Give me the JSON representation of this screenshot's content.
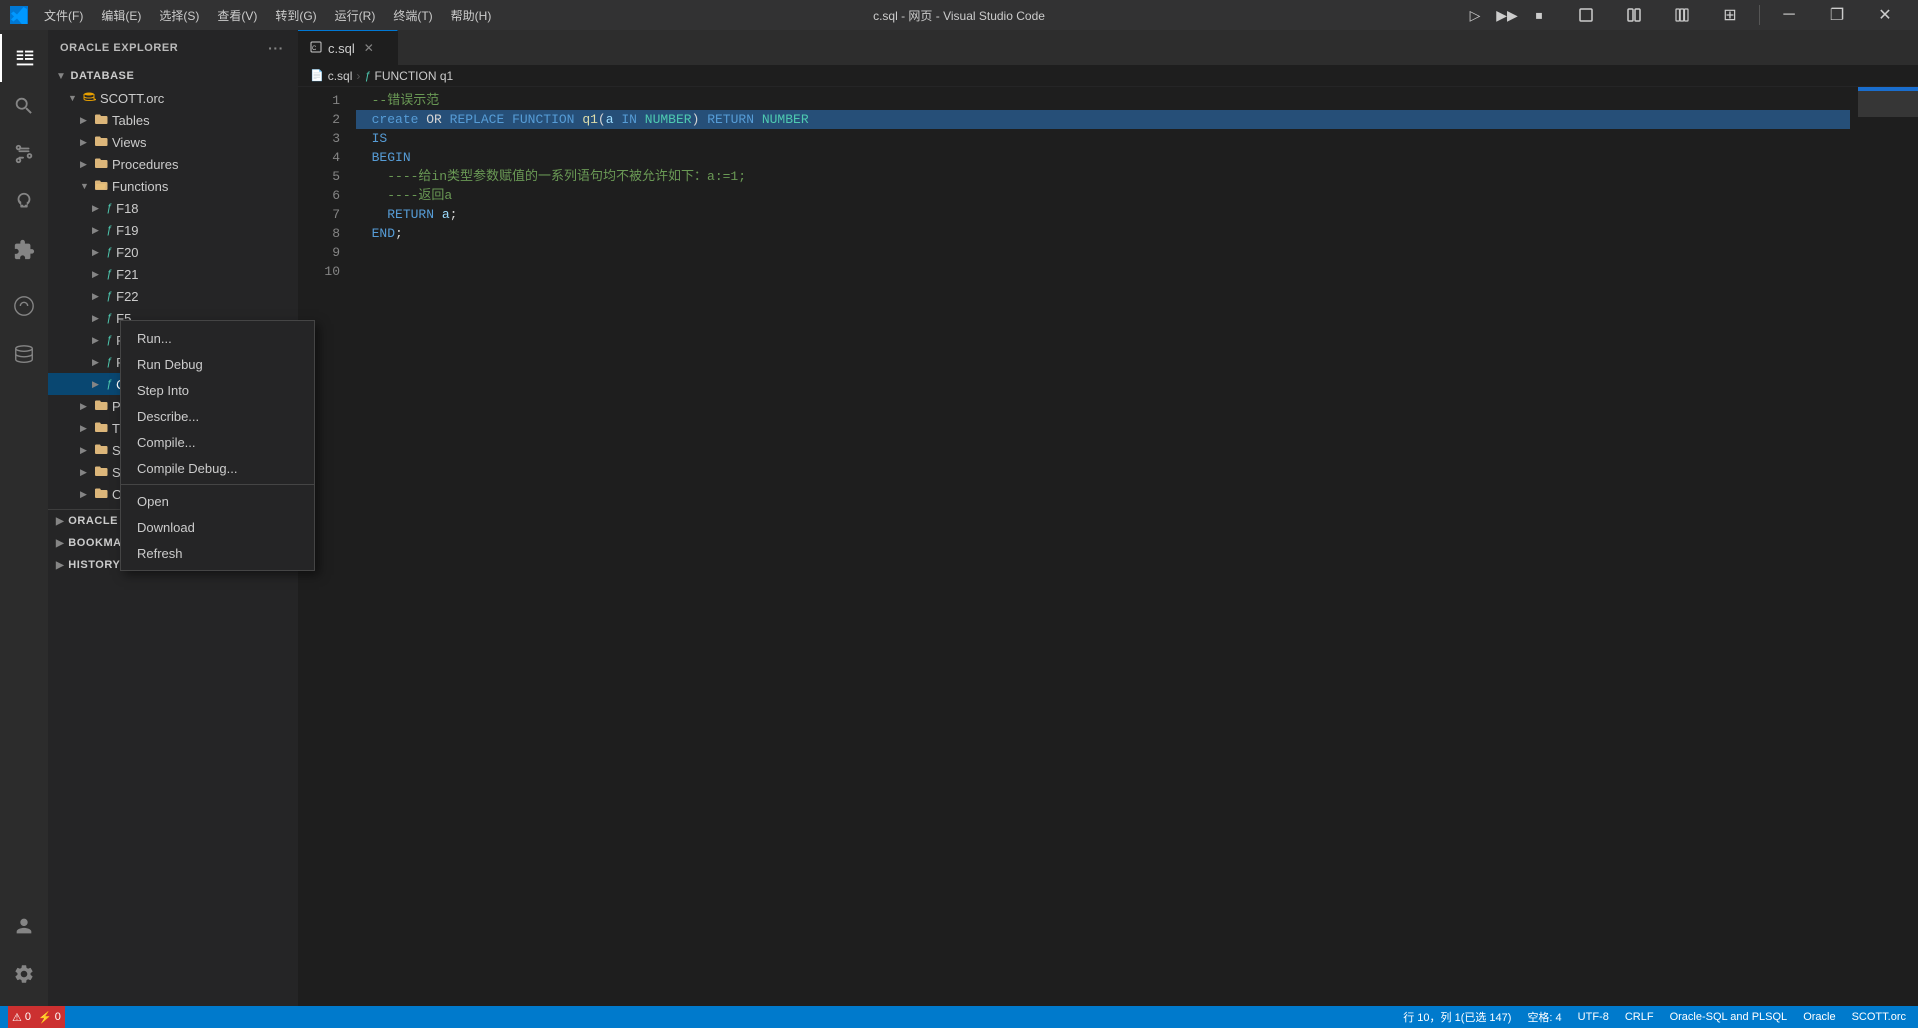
{
  "titlebar": {
    "logo": "◆",
    "menus": [
      "文件(F)",
      "编辑(E)",
      "选择(S)",
      "查看(V)",
      "转到(G)",
      "运行(R)",
      "终端(T)",
      "帮助(H)"
    ],
    "title": "c.sql - 网页 - Visual Studio Code",
    "btn_minimize": "─",
    "btn_restore": "⧠",
    "btn_maximize": "❐",
    "btn_layout": "⊞",
    "btn_close": "✕"
  },
  "activity_bar": {
    "icons": [
      {
        "name": "explorer-icon",
        "symbol": "⎘",
        "active": true
      },
      {
        "name": "search-icon",
        "symbol": "🔍",
        "active": false
      },
      {
        "name": "source-control-icon",
        "symbol": "⑂",
        "active": false
      },
      {
        "name": "run-debug-icon",
        "symbol": "▷",
        "active": false
      },
      {
        "name": "extensions-icon",
        "symbol": "⊞",
        "active": false
      },
      {
        "name": "oracle-icon",
        "symbol": "⬡",
        "active": false
      },
      {
        "name": "database-icon",
        "symbol": "🗄",
        "active": false
      }
    ],
    "bottom_icons": [
      {
        "name": "accounts-icon",
        "symbol": "◎"
      },
      {
        "name": "settings-icon",
        "symbol": "⚙"
      }
    ]
  },
  "sidebar": {
    "header": "ORACLE EXPLORER",
    "more_icon": "···",
    "sections": {
      "database": {
        "label": "DATABASE",
        "expanded": true,
        "items": [
          {
            "label": "SCOTT.orc",
            "level": 2,
            "expanded": true,
            "icon": "🗄",
            "children": [
              {
                "label": "Tables",
                "level": 3,
                "icon": "📁",
                "expanded": false
              },
              {
                "label": "Views",
                "level": 3,
                "icon": "📁",
                "expanded": false
              },
              {
                "label": "Procedures",
                "level": 3,
                "icon": "📁",
                "expanded": false
              },
              {
                "label": "Functions",
                "level": 3,
                "icon": "📁",
                "expanded": true,
                "children": [
                  {
                    "label": "F18",
                    "level": 4,
                    "icon": "ƒ",
                    "selected": false
                  },
                  {
                    "label": "F19",
                    "level": 4,
                    "icon": "ƒ",
                    "selected": false
                  },
                  {
                    "label": "F20",
                    "level": 4,
                    "icon": "ƒ",
                    "selected": false
                  },
                  {
                    "label": "F21",
                    "level": 4,
                    "icon": "ƒ",
                    "selected": false
                  },
                  {
                    "label": "F22",
                    "level": 4,
                    "icon": "ƒ",
                    "selected": false
                  },
                  {
                    "label": "F5",
                    "level": 4,
                    "icon": "ƒ",
                    "selected": false
                  },
                  {
                    "label": "F6",
                    "level": 4,
                    "icon": "ƒ",
                    "selected": false
                  },
                  {
                    "label": "F7",
                    "level": 4,
                    "icon": "ƒ",
                    "selected": false
                  },
                  {
                    "label": "Q1",
                    "level": 4,
                    "icon": "ƒ",
                    "selected": true
                  }
                ]
              },
              {
                "label": "Packages",
                "level": 3,
                "icon": "📁",
                "expanded": false
              },
              {
                "label": "Triggers",
                "level": 3,
                "icon": "📁",
                "expanded": false
              },
              {
                "label": "Synonyms",
                "level": 3,
                "icon": "📁",
                "expanded": false
              },
              {
                "label": "Sequences",
                "level": 3,
                "icon": "📁",
                "expanded": false
              },
              {
                "label": "Other",
                "level": 3,
                "icon": "📁",
                "expanded": false
              }
            ]
          }
        ]
      },
      "oracle_cloud": {
        "label": "ORACLE CLOUD INFRASTRUCTURE",
        "expanded": false
      },
      "bookmarks": {
        "label": "BOOKMARKS",
        "expanded": false
      },
      "history": {
        "label": "HISTORY",
        "expanded": false
      }
    }
  },
  "tabs": [
    {
      "label": "c.sql",
      "active": true,
      "icon": "📄",
      "closeable": true
    }
  ],
  "breadcrumb": {
    "items": [
      "c.sql",
      "FUNCTION q1"
    ],
    "icons": [
      "📄",
      "ƒ"
    ]
  },
  "editor": {
    "lines": [
      {
        "num": 1,
        "content": "  --错误示范",
        "classes": "cmt"
      },
      {
        "num": 2,
        "content": "  create OR REPLACE FUNCTION q1(a IN NUMBER) RETURN NUMBER",
        "highlight": true
      },
      {
        "num": 3,
        "content": "  IS",
        "classes": "kw"
      },
      {
        "num": 4,
        "content": "  BEGIN",
        "classes": "kw"
      },
      {
        "num": 5,
        "content": "    ----给in类型参数赋值的一系列语句均不被允许如下：a:=1;",
        "classes": "cmt"
      },
      {
        "num": 6,
        "content": "    ----返回a",
        "classes": "cmt"
      },
      {
        "num": 7,
        "content": "    RETURN a;"
      },
      {
        "num": 8,
        "content": "  END;"
      },
      {
        "num": 9,
        "content": ""
      },
      {
        "num": 10,
        "content": ""
      }
    ]
  },
  "context_menu": {
    "visible": true,
    "position_note": "shown at Q1 item",
    "items": [
      {
        "label": "Run...",
        "name": "run-menu-item",
        "separator_after": false
      },
      {
        "label": "Run Debug",
        "name": "run-debug-menu-item",
        "separator_after": false
      },
      {
        "label": "Step Into",
        "name": "step-into-menu-item",
        "separator_after": false
      },
      {
        "label": "Describe...",
        "name": "describe-menu-item",
        "separator_after": false
      },
      {
        "label": "Compile...",
        "name": "compile-menu-item",
        "separator_after": false
      },
      {
        "label": "Compile Debug...",
        "name": "compile-debug-menu-item",
        "separator_after": true
      },
      {
        "label": "Open",
        "name": "open-menu-item",
        "separator_after": false
      },
      {
        "label": "Download",
        "name": "download-menu-item",
        "separator_after": false
      },
      {
        "label": "Refresh",
        "name": "refresh-menu-item",
        "separator_after": false
      }
    ]
  },
  "status_bar": {
    "left_items": [
      {
        "label": "⚠ 0",
        "name": "errors-status"
      },
      {
        "label": "⚡ 0",
        "name": "warnings-status"
      }
    ],
    "right_items": [
      {
        "label": "行 10，列 1(已选 147)",
        "name": "cursor-position"
      },
      {
        "label": "空格: 4",
        "name": "indent-status"
      },
      {
        "label": "UTF-8",
        "name": "encoding-status"
      },
      {
        "label": "CRLF",
        "name": "line-ending-status"
      },
      {
        "label": "Oracle-SQL and PLSQL",
        "name": "language-status"
      },
      {
        "label": "Oracle",
        "name": "oracle-status"
      },
      {
        "label": "SCOTT.orc",
        "name": "connection-status"
      }
    ]
  },
  "run_controls": {
    "play_icon": "▷",
    "play_all_icon": "▶▶",
    "stop_icon": "⏹"
  }
}
